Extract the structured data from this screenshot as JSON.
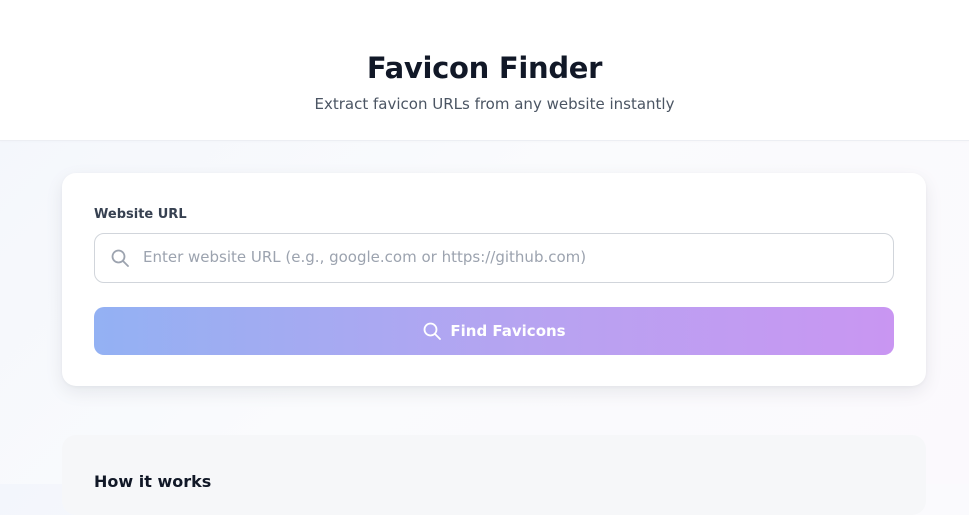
{
  "header": {
    "title": "Favicon Finder",
    "subtitle": "Extract favicon URLs from any website instantly"
  },
  "form": {
    "label": "Website URL",
    "input_value": "",
    "placeholder": "Enter website URL (e.g., google.com or https://github.com)",
    "input_icon": "search-icon",
    "button_label": "Find Favicons",
    "button_icon": "search-icon"
  },
  "how_it_works": {
    "title": "How it works"
  },
  "colors": {
    "button_gradient_start": "#93b1f3",
    "button_gradient_end": "#c996f2",
    "title_text": "#111827",
    "subtitle_text": "#4b5563"
  }
}
